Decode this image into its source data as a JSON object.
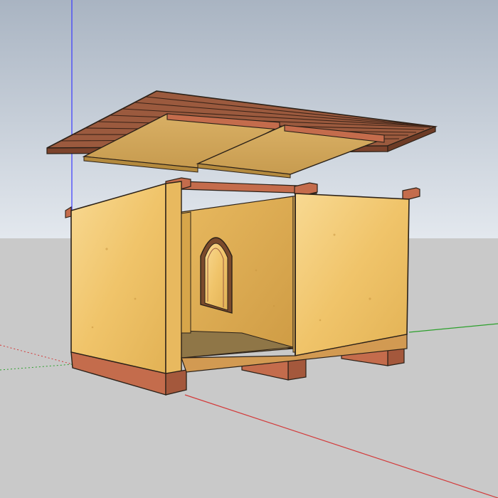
{
  "app": {
    "type": "3d-modeling-viewport",
    "ui_text": []
  },
  "scene": {
    "model": "dog-house",
    "description_parts": [
      "roof-deck-planks",
      "roof-panels",
      "top-beams",
      "back-wall-with-arched-window",
      "left-wall",
      "right-wall",
      "front-divider-panel",
      "floor",
      "base-skids"
    ],
    "axes": [
      "blue-vertical-axis",
      "green-axis",
      "red-axis"
    ]
  },
  "colors": {
    "sky_top": "#a9b4c2",
    "sky_bottom": "#e3e8ee",
    "ground": "#c9c9c9",
    "plywood": "#f0c46a",
    "plywood_light": "#f8d992",
    "plywood_dark": "#d7a64a",
    "timber": "#c46c4c",
    "timber_dark": "#8f4b32",
    "roof_plank": "#9b5a3e",
    "outline": "#2b2118",
    "axis_blue": "#3a3aff",
    "axis_green": "#2ca02c",
    "axis_red": "#d33a3a"
  }
}
